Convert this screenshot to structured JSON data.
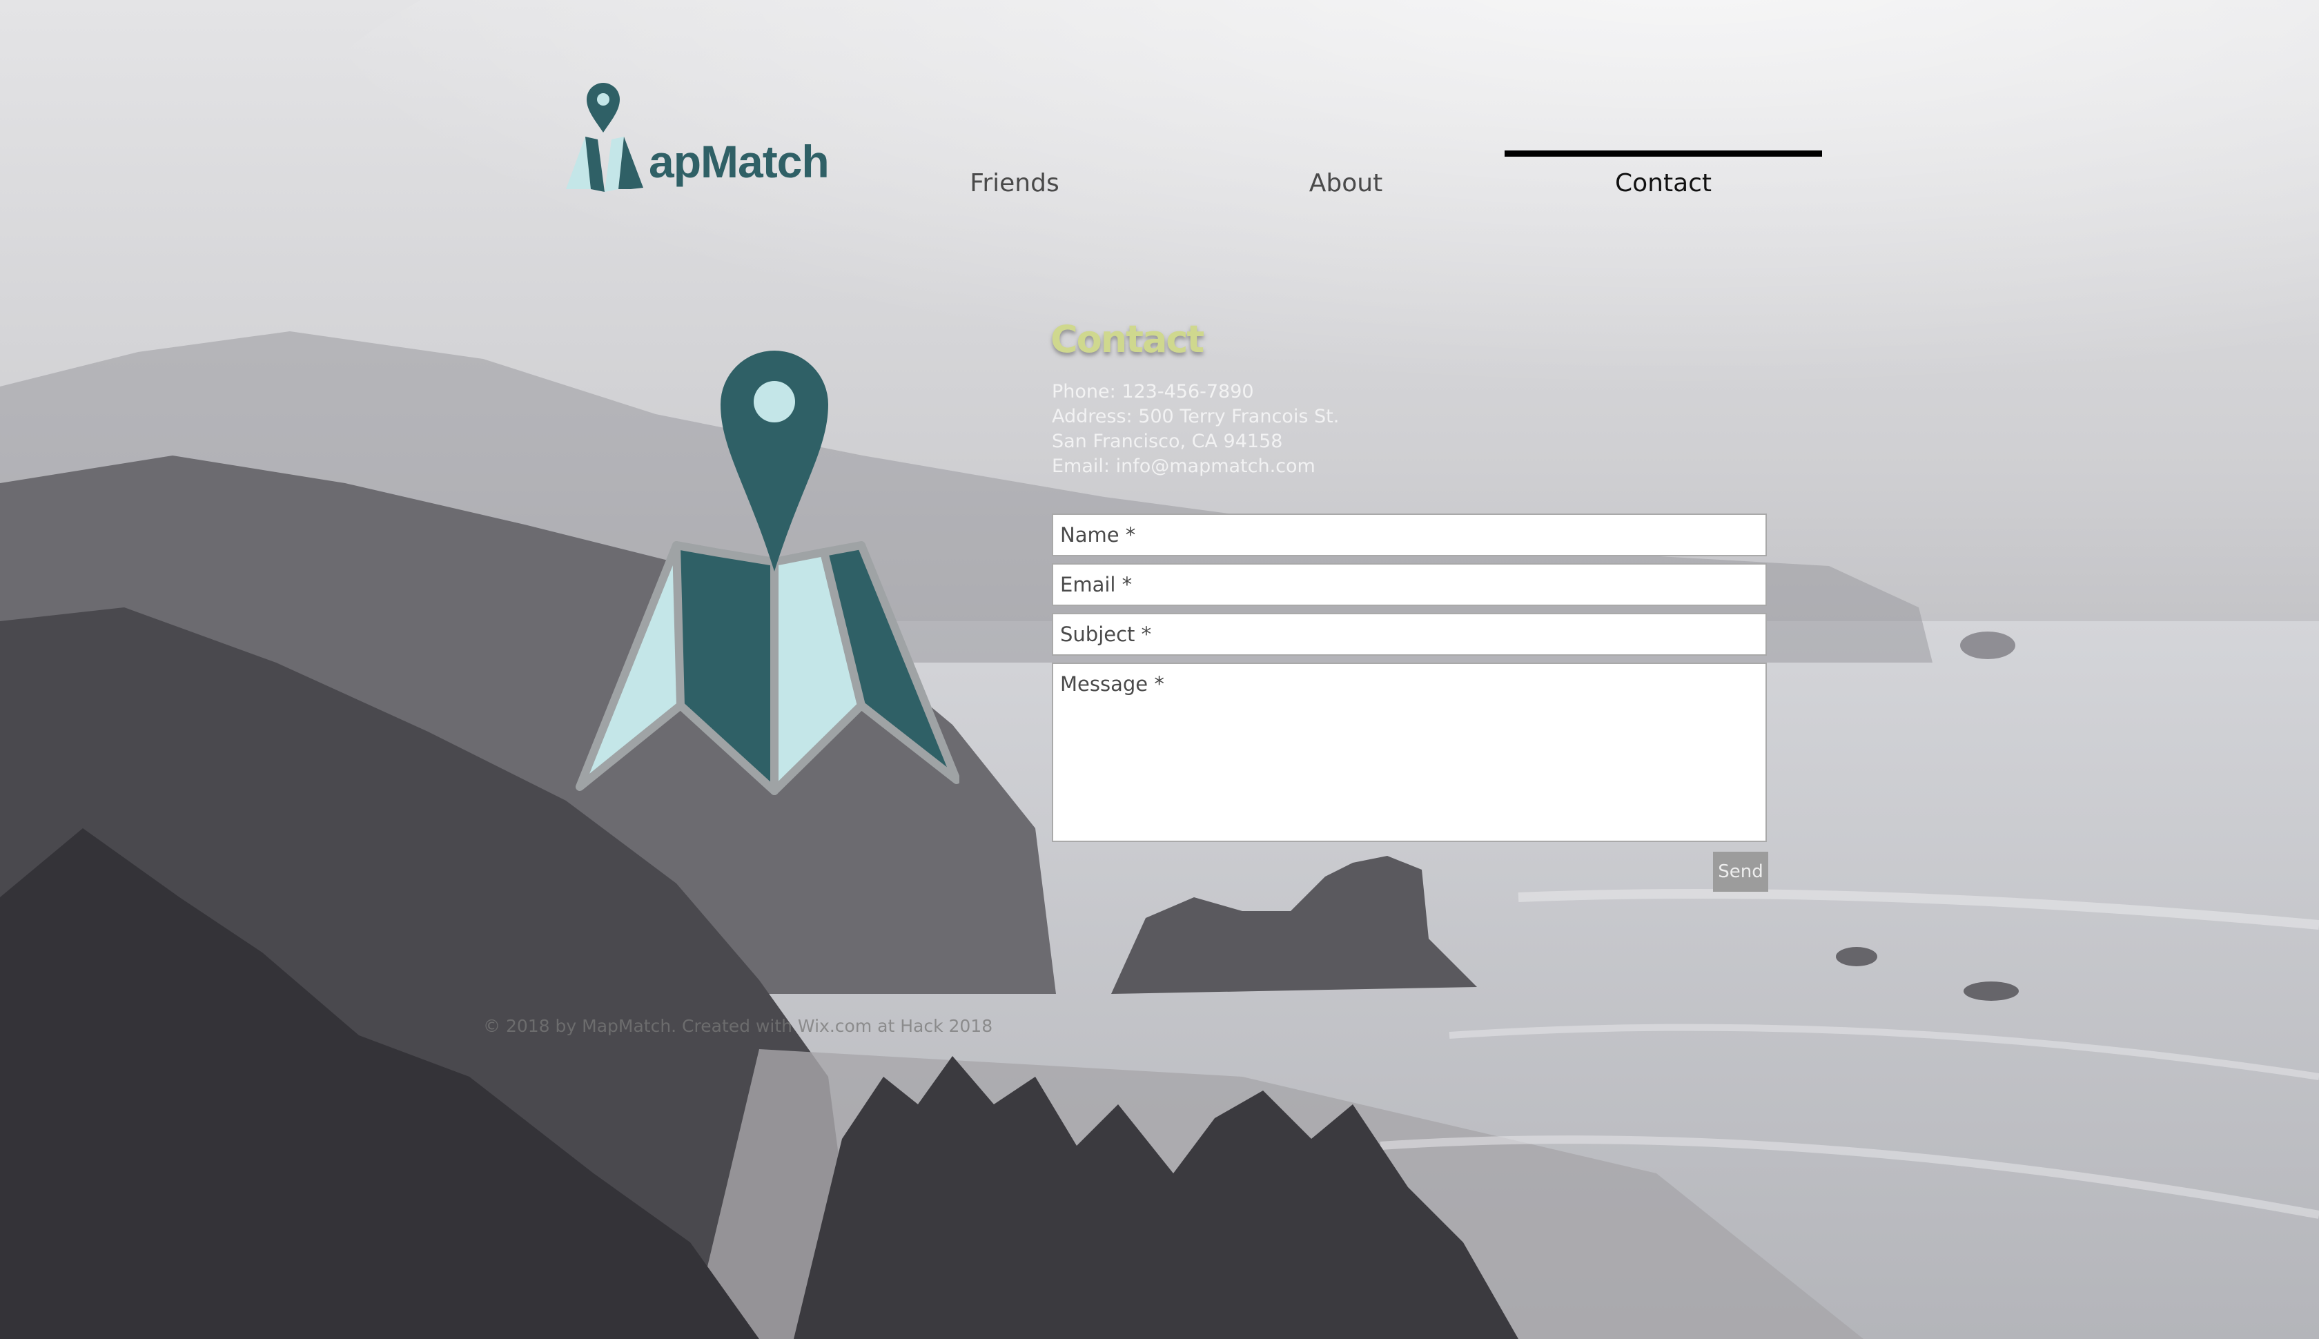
{
  "header": {
    "brand_name": "apMatch",
    "nav": [
      {
        "label": "Friends",
        "active": false
      },
      {
        "label": "About",
        "active": false
      },
      {
        "label": "Contact",
        "active": true
      }
    ]
  },
  "contact": {
    "title": "Contact",
    "phone": "Phone: 123-456-7890",
    "address_line1": "Address: 500 Terry Francois St.",
    "address_line2": "San Francisco, CA 94158",
    "email": "Email: info@mapmatch.com"
  },
  "form": {
    "name_placeholder": "Name *",
    "email_placeholder": "Email *",
    "subject_placeholder": "Subject *",
    "message_placeholder": "Message *",
    "send_label": "Send"
  },
  "footer": {
    "text": "© 2018 by MapMatch. Created with Wix.com at Hack 2018"
  },
  "colors": {
    "brand_teal": "#2f6066",
    "light_teal": "#c4e6e8",
    "title_green": "#cfd88e"
  },
  "icons": {
    "logo": "map-pin-icon",
    "hero": "map-pin-icon"
  }
}
